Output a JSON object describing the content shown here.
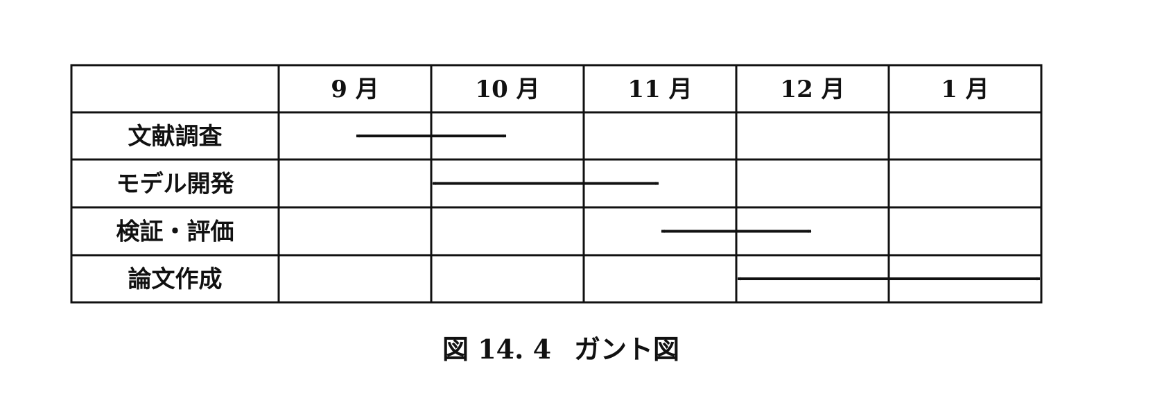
{
  "diagram": {
    "months": [
      "9 月",
      "10 月",
      "11 月",
      "12 月",
      "1 月"
    ],
    "tasks": [
      {
        "label": "文献調査",
        "start": 0.5,
        "end": 1.5
      },
      {
        "label": "モデル開発",
        "start": 1.0,
        "end": 2.5
      },
      {
        "label": "検証・評価",
        "start": 2.5,
        "end": 3.5
      },
      {
        "label": "論文作成",
        "start": 3.0,
        "end": 5.0
      }
    ],
    "caption_number": "図 14. 4",
    "caption_title": "ガント図",
    "line_color": "#111111"
  }
}
